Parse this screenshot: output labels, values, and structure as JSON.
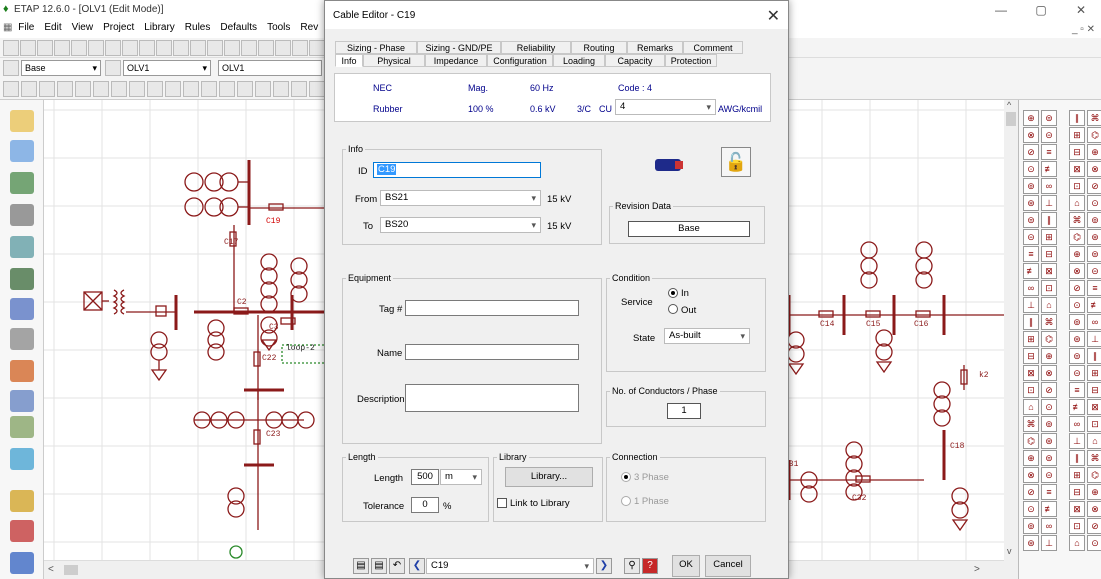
{
  "app": {
    "title": "ETAP 12.6.0 - [OLV1 (Edit Mode)]",
    "menu": [
      "File",
      "Edit",
      "View",
      "Project",
      "Library",
      "Rules",
      "Defaults",
      "Tools",
      "Rev"
    ],
    "win_controls": {
      "min": "—",
      "max": "▢",
      "close": "✕"
    },
    "mdi_controls": "_ ▫ ✕"
  },
  "toolbar": {
    "config_combo": "Base",
    "olv_combo": "OLV1",
    "olv_combo2": "OLV1"
  },
  "diagram_labels": {
    "c17": "C17",
    "c19": "C19",
    "c2": "C2",
    "c3": "C3",
    "c22": "C22",
    "c23": "C23",
    "loop2": "loop-2",
    "c14": "C14",
    "c15": "C15",
    "c16": "C16",
    "c18": "C18",
    "c31": "C31",
    "c32": "C32",
    "k2": "k2"
  },
  "dialog": {
    "title": "Cable Editor - C19",
    "close_label": "✕",
    "tabs_row1": [
      "Sizing - Phase",
      "Sizing - GND/PE",
      "Reliability",
      "Routing",
      "Remarks",
      "Comment"
    ],
    "tabs_row2": [
      "Info",
      "Physical",
      "Impedance",
      "Configuration",
      "Loading",
      "Capacity",
      "Protection"
    ],
    "summary": {
      "standard": "NEC",
      "insulation": "Rubber",
      "mag_label": "Mag.",
      "mag_pct": "100 %",
      "freq": "60 Hz",
      "voltage": "0.6 kV",
      "code": "Code : 4",
      "conductors": "3/C",
      "material": "CU",
      "size": "4",
      "unit": "AWG/kcmil"
    },
    "info": {
      "group": "Info",
      "id_label": "ID",
      "id_value": "C19",
      "from_label": "From",
      "from_value": "BS21",
      "from_kv": "15 kV",
      "to_label": "To",
      "to_value": "BS20",
      "to_kv": "15 kV"
    },
    "revision": {
      "group": "Revision Data",
      "value": "Base"
    },
    "equipment": {
      "group": "Equipment",
      "tag_label": "Tag #",
      "tag_value": "",
      "name_label": "Name",
      "name_value": "",
      "desc_label": "Description",
      "desc_value": ""
    },
    "condition": {
      "group": "Condition",
      "service_label": "Service",
      "in_label": "In",
      "out_label": "Out",
      "state_label": "State",
      "state_value": "As-built"
    },
    "conductors_phase": {
      "group": "No. of Conductors / Phase",
      "value": "1"
    },
    "length": {
      "group": "Length",
      "length_label": "Length",
      "length_value": "500",
      "length_unit": "m",
      "tol_label": "Tolerance",
      "tol_value": "0",
      "tol_unit": "%"
    },
    "library": {
      "group": "Library",
      "button": "Library...",
      "link_label": "Link to Library"
    },
    "connection": {
      "group": "Connection",
      "three_phase": "3 Phase",
      "one_phase": "1 Phase"
    },
    "footer": {
      "element": "C19",
      "ok": "OK",
      "cancel": "Cancel",
      "help": "?"
    }
  },
  "colors": {
    "diagram": "#8b1a1a",
    "selection": "#3399ff",
    "accent": "#0078d7"
  }
}
